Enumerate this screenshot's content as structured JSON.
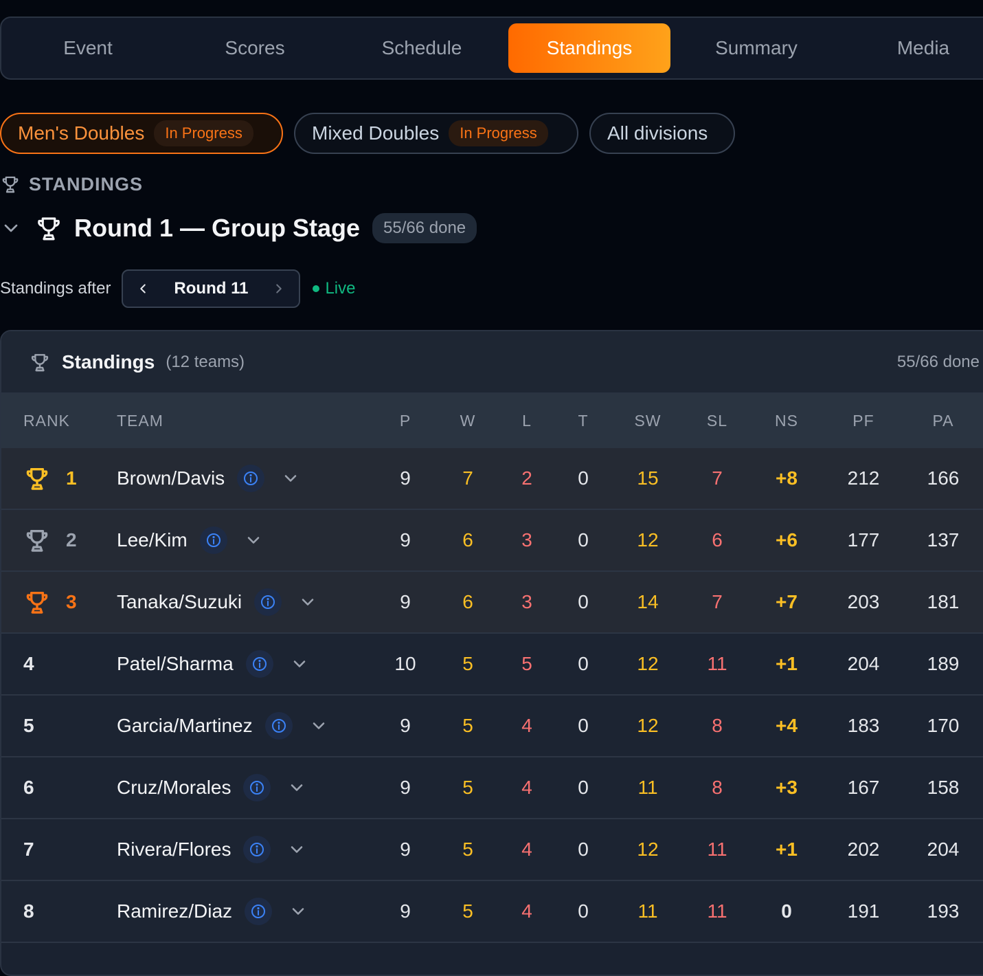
{
  "tabs": [
    {
      "label": "Event",
      "active": false
    },
    {
      "label": "Scores",
      "active": false
    },
    {
      "label": "Schedule",
      "active": false
    },
    {
      "label": "Standings",
      "active": true
    },
    {
      "label": "Summary",
      "active": false
    },
    {
      "label": "Media",
      "active": false
    }
  ],
  "divisions": [
    {
      "label": "Men's Doubles",
      "badge": "In Progress",
      "active": true
    },
    {
      "label": "Mixed Doubles",
      "badge": "In Progress",
      "active": false
    },
    {
      "label": "All divisions",
      "badge": "",
      "active": false
    }
  ],
  "section_label": "STANDINGS",
  "round": {
    "title": "Round 1 — Group Stage",
    "done": "55/66 done"
  },
  "standings_after": {
    "label": "Standings after",
    "round": "Round 11",
    "live": "Live"
  },
  "card": {
    "title": "Standings",
    "count": "(12 teams)",
    "done": "55/66 done"
  },
  "columns": [
    "RANK",
    "TEAM",
    "P",
    "W",
    "L",
    "T",
    "SW",
    "SL",
    "NS",
    "PF",
    "PA"
  ],
  "rows": [
    {
      "rank": "1",
      "trophy": "gold",
      "team": "Brown/Davis",
      "p": "9",
      "w": "7",
      "l": "2",
      "t": "0",
      "sw": "15",
      "sl": "7",
      "ns": "+8",
      "pf": "212",
      "pa": "166"
    },
    {
      "rank": "2",
      "trophy": "silver",
      "team": "Lee/Kim",
      "p": "9",
      "w": "6",
      "l": "3",
      "t": "0",
      "sw": "12",
      "sl": "6",
      "ns": "+6",
      "pf": "177",
      "pa": "137"
    },
    {
      "rank": "3",
      "trophy": "bronze",
      "team": "Tanaka/Suzuki",
      "p": "9",
      "w": "6",
      "l": "3",
      "t": "0",
      "sw": "14",
      "sl": "7",
      "ns": "+7",
      "pf": "203",
      "pa": "181"
    },
    {
      "rank": "4",
      "trophy": "",
      "team": "Patel/Sharma",
      "p": "10",
      "w": "5",
      "l": "5",
      "t": "0",
      "sw": "12",
      "sl": "11",
      "ns": "+1",
      "pf": "204",
      "pa": "189"
    },
    {
      "rank": "5",
      "trophy": "",
      "team": "Garcia/Martinez",
      "p": "9",
      "w": "5",
      "l": "4",
      "t": "0",
      "sw": "12",
      "sl": "8",
      "ns": "+4",
      "pf": "183",
      "pa": "170"
    },
    {
      "rank": "6",
      "trophy": "",
      "team": "Cruz/Morales",
      "p": "9",
      "w": "5",
      "l": "4",
      "t": "0",
      "sw": "11",
      "sl": "8",
      "ns": "+3",
      "pf": "167",
      "pa": "158"
    },
    {
      "rank": "7",
      "trophy": "",
      "team": "Rivera/Flores",
      "p": "9",
      "w": "5",
      "l": "4",
      "t": "0",
      "sw": "12",
      "sl": "11",
      "ns": "+1",
      "pf": "202",
      "pa": "204"
    },
    {
      "rank": "8",
      "trophy": "",
      "team": "Ramirez/Diaz",
      "p": "9",
      "w": "5",
      "l": "4",
      "t": "0",
      "sw": "11",
      "sl": "11",
      "ns": "0",
      "pf": "191",
      "pa": "193"
    }
  ],
  "colors": {
    "accent": "#f97316",
    "win": "#fbbf24",
    "loss": "#f87171",
    "live": "#10b981"
  }
}
